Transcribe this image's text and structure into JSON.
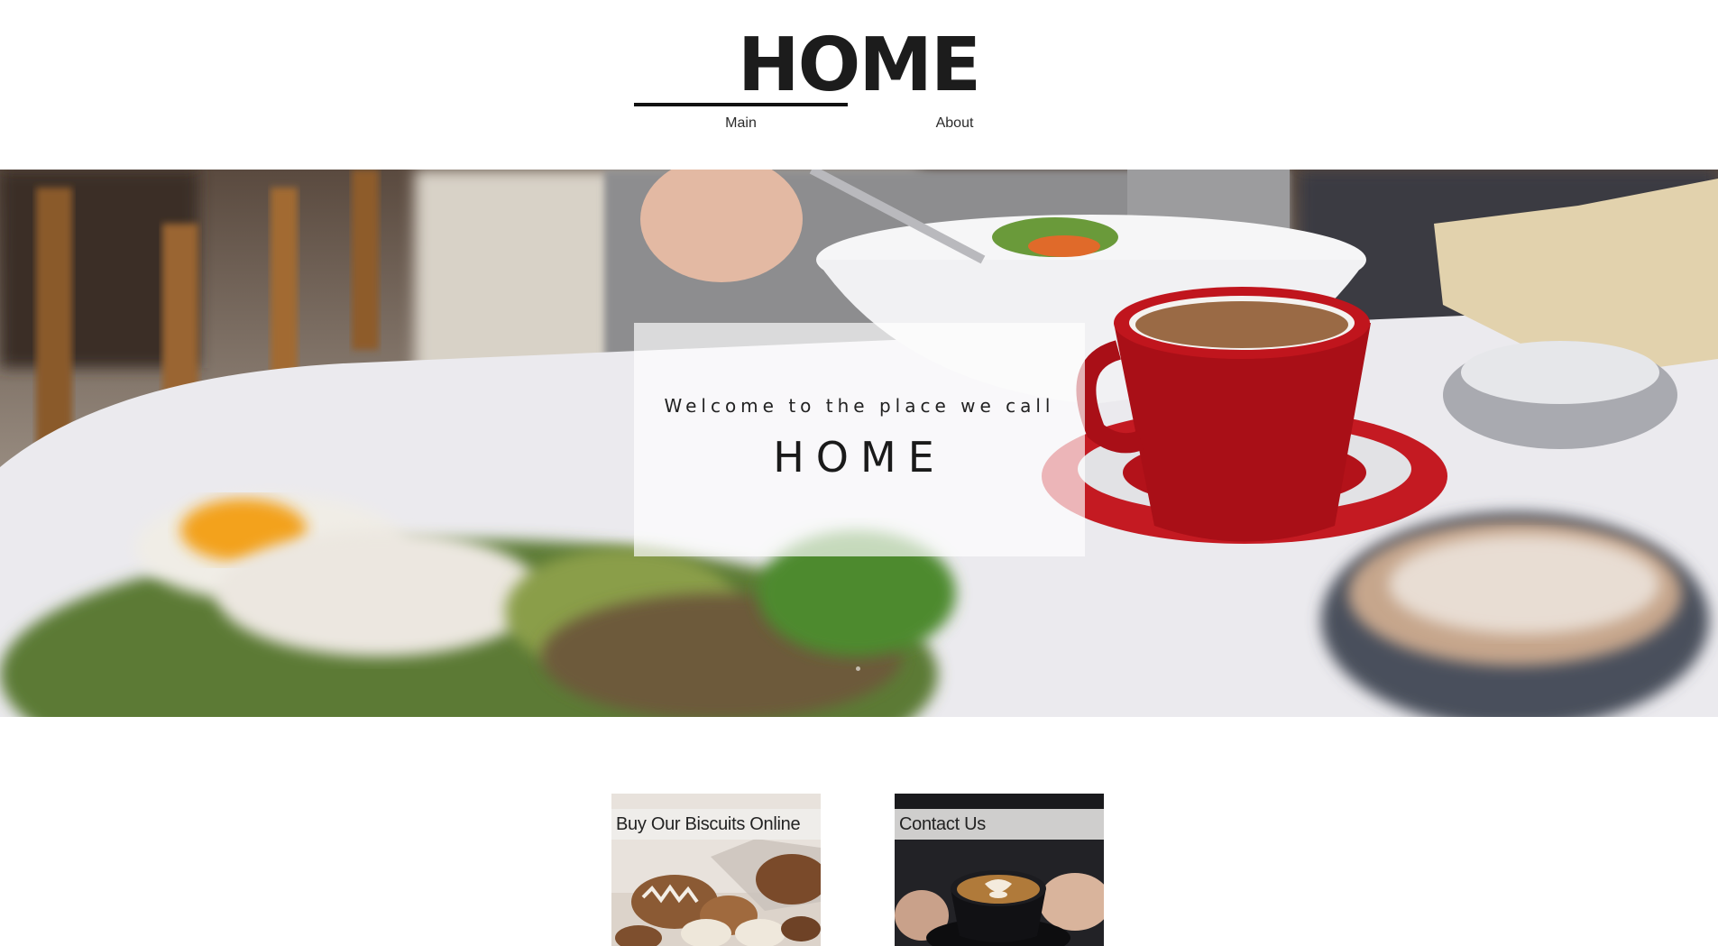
{
  "header": {
    "logo_text": "HOME",
    "nav": [
      {
        "label": "Main",
        "active": true
      },
      {
        "label": "About",
        "active": false
      }
    ]
  },
  "hero": {
    "subtitle": "Welcome to the place we call",
    "title": "HOME"
  },
  "cards": [
    {
      "label": "Buy Our Biscuits Online"
    },
    {
      "label": "Contact Us"
    }
  ],
  "colors": {
    "accent_dark": "#111111",
    "cup_red": "#b3121a"
  }
}
